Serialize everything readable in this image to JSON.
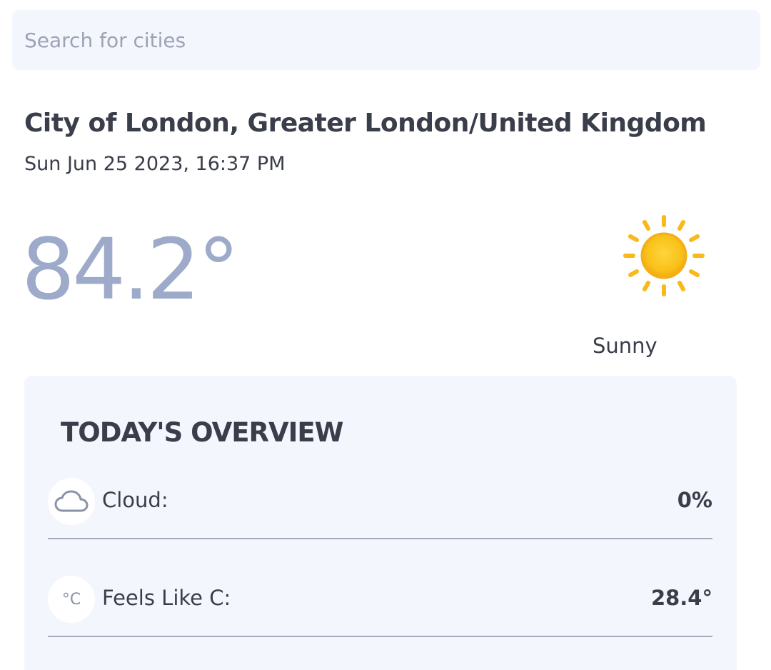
{
  "search": {
    "placeholder": "Search for cities",
    "value": ""
  },
  "location": {
    "name": "City of London, Greater London/United Kingdom",
    "datetime": "Sun Jun 25 2023, 16:37 PM"
  },
  "current": {
    "temperature": "84.2°",
    "condition": "Sunny",
    "icon": "sun-icon"
  },
  "overview": {
    "title": "TODAY'S OVERVIEW",
    "rows": [
      {
        "icon": "cloud-icon",
        "label": "Cloud:",
        "value": "0%"
      },
      {
        "icon": "celsius-icon",
        "icon_text": "°C",
        "label": "Feels Like C:",
        "value": "28.4°"
      }
    ]
  },
  "colors": {
    "temperature": "#9daac9",
    "card_background": "#f4f6fd",
    "text": "#3a3d4a",
    "sun": "#f9c21a"
  }
}
